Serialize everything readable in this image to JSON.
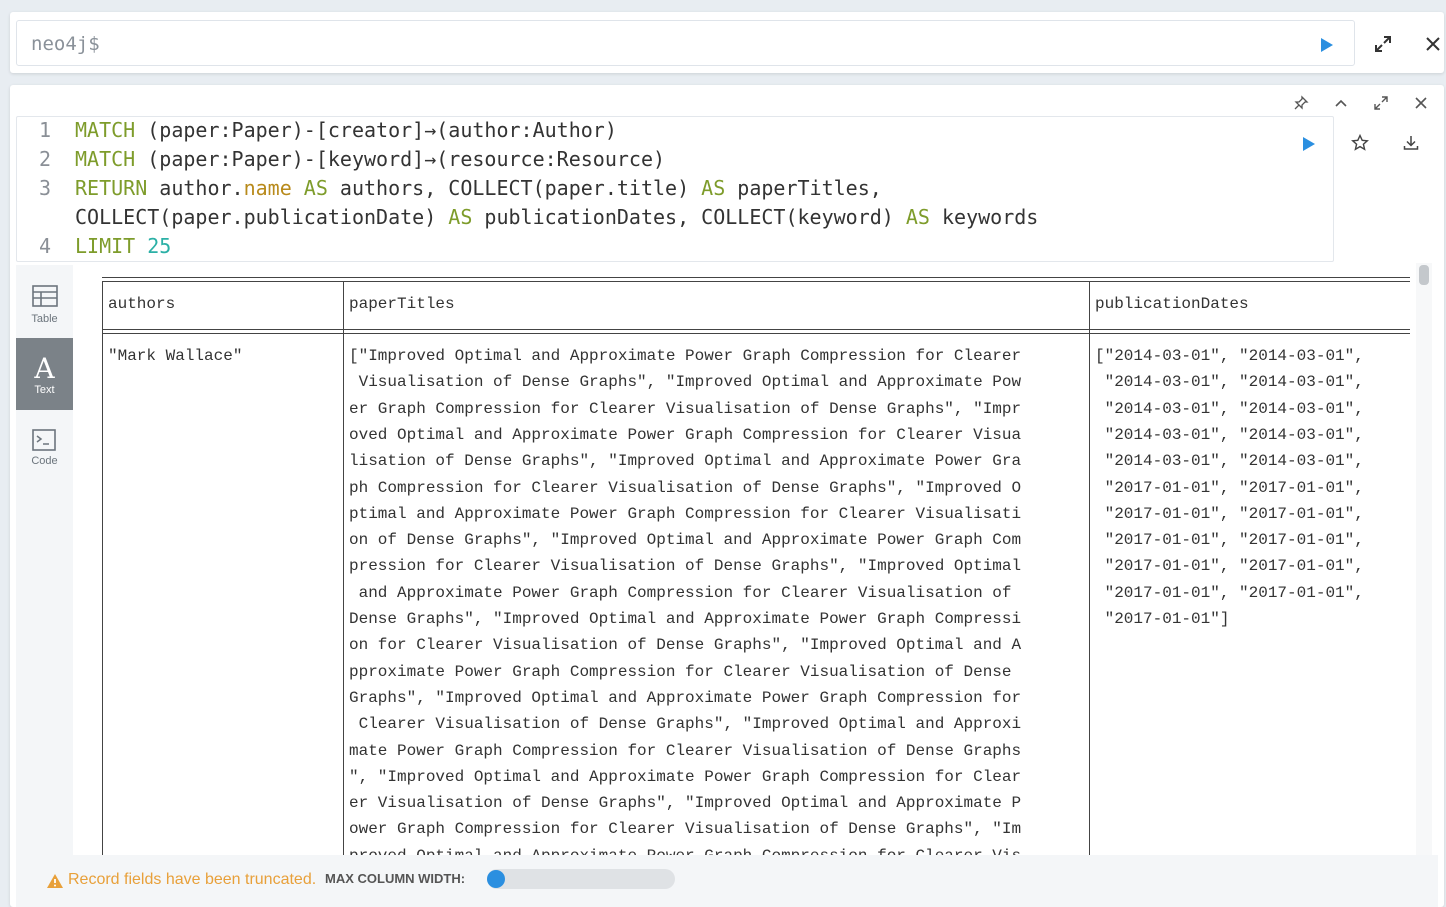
{
  "editor": {
    "prompt": "neo4j$"
  },
  "query": {
    "lines": [
      {
        "num": "1",
        "tokens": [
          {
            "t": "MATCH",
            "c": "kw"
          },
          {
            "t": " (paper:Paper)-[creator]→(author:Author)",
            "c": ""
          }
        ]
      },
      {
        "num": "2",
        "tokens": [
          {
            "t": "MATCH",
            "c": "kw"
          },
          {
            "t": " (paper:Paper)-[keyword]→(resource:Resource)",
            "c": ""
          }
        ]
      },
      {
        "num": "3",
        "tokens": [
          {
            "t": "RETURN",
            "c": "kw"
          },
          {
            "t": " author.",
            "c": ""
          },
          {
            "t": "name",
            "c": "prop"
          },
          {
            "t": " ",
            "c": ""
          },
          {
            "t": "AS",
            "c": "kw"
          },
          {
            "t": " authors, COLLECT(paper.title) ",
            "c": ""
          },
          {
            "t": "AS",
            "c": "kw"
          },
          {
            "t": " paperTitles,",
            "c": ""
          }
        ]
      },
      {
        "num": "",
        "tokens": [
          {
            "t": "COLLECT(paper.publicationDate) ",
            "c": ""
          },
          {
            "t": "AS",
            "c": "kw"
          },
          {
            "t": " publicationDates, COLLECT(keyword) ",
            "c": ""
          },
          {
            "t": "AS",
            "c": "kw"
          },
          {
            "t": " keywords",
            "c": ""
          }
        ]
      },
      {
        "num": "4",
        "tokens": [
          {
            "t": "LIMIT",
            "c": "kw"
          },
          {
            "t": " ",
            "c": ""
          },
          {
            "t": "25",
            "c": "num"
          }
        ]
      }
    ]
  },
  "sidebar": {
    "items": [
      {
        "label": "Table",
        "icon": "table-icon",
        "active": false
      },
      {
        "label": "Text",
        "icon": "text-icon",
        "active": true
      },
      {
        "label": "Code",
        "icon": "code-icon",
        "active": false
      }
    ]
  },
  "results": {
    "headers": [
      "authors",
      "paperTitles",
      "publicationDates"
    ],
    "authors": [
      "\"Mark Wallace\""
    ],
    "paperTitles": [
      "[\"Improved Optimal and Approximate Power Graph Compression for Clearer",
      " Visualisation of Dense Graphs\", \"Improved Optimal and Approximate Pow",
      "er Graph Compression for Clearer Visualisation of Dense Graphs\", \"Impr",
      "oved Optimal and Approximate Power Graph Compression for Clearer Visua",
      "lisation of Dense Graphs\", \"Improved Optimal and Approximate Power Gra",
      "ph Compression for Clearer Visualisation of Dense Graphs\", \"Improved O",
      "ptimal and Approximate Power Graph Compression for Clearer Visualisati",
      "on of Dense Graphs\", \"Improved Optimal and Approximate Power Graph Com",
      "pression for Clearer Visualisation of Dense Graphs\", \"Improved Optimal",
      " and Approximate Power Graph Compression for Clearer Visualisation of ",
      "Dense Graphs\", \"Improved Optimal and Approximate Power Graph Compressi",
      "on for Clearer Visualisation of Dense Graphs\", \"Improved Optimal and A",
      "pproximate Power Graph Compression for Clearer Visualisation of Dense ",
      "Graphs\", \"Improved Optimal and Approximate Power Graph Compression for",
      " Clearer Visualisation of Dense Graphs\", \"Improved Optimal and Approxi",
      "mate Power Graph Compression for Clearer Visualisation of Dense Graphs",
      "\", \"Improved Optimal and Approximate Power Graph Compression for Clear",
      "er Visualisation of Dense Graphs\", \"Improved Optimal and Approximate P",
      "ower Graph Compression for Clearer Visualisation of Dense Graphs\", \"Im",
      "proved Optimal and Approximate Power Graph Compression for Clearer Vis"
    ],
    "publicationDates": [
      "[\"2014-03-01\", \"2014-03-01\",",
      " \"2014-03-01\", \"2014-03-01\",",
      " \"2014-03-01\", \"2014-03-01\",",
      " \"2014-03-01\", \"2014-03-01\",",
      " \"2014-03-01\", \"2014-03-01\",",
      " \"2017-01-01\", \"2017-01-01\",",
      " \"2017-01-01\", \"2017-01-01\",",
      " \"2017-01-01\", \"2017-01-01\",",
      " \"2017-01-01\", \"2017-01-01\",",
      " \"2017-01-01\", \"2017-01-01\",",
      " \"2017-01-01\"]"
    ]
  },
  "footer": {
    "warning": "Record fields have been truncated.",
    "max_width_label": "MAX COLUMN WIDTH:",
    "slider_value": 0
  },
  "colors": {
    "accent": "#2b8fe0",
    "warning": "#e8a03a",
    "keyword": "#7e9c2b"
  }
}
